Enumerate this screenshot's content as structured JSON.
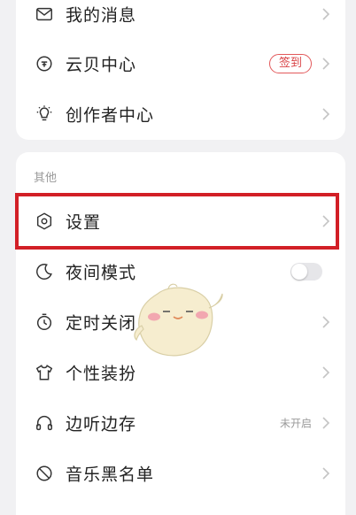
{
  "section_other_label": "其他",
  "menu": {
    "messages": {
      "label": "我的消息",
      "icon": "mail-icon"
    },
    "yunbei": {
      "label": "云贝中心",
      "badge": "签到",
      "icon": "yunbei-coin-icon"
    },
    "creator": {
      "label": "创作者中心",
      "icon": "lightbulb-icon"
    },
    "settings": {
      "label": "设置",
      "icon": "settings-hexagon-icon"
    },
    "night_mode": {
      "label": "夜间模式",
      "icon": "moon-icon",
      "toggle_on": false
    },
    "timer_close": {
      "label": "定时关闭",
      "icon": "timer-icon"
    },
    "theme": {
      "label": "个性装扮",
      "icon": "tshirt-icon"
    },
    "listen_save": {
      "label": "边听边存",
      "status": "未开启",
      "icon": "headphones-icon"
    },
    "blacklist": {
      "label": "音乐黑名单",
      "icon": "block-icon"
    }
  },
  "colors": {
    "highlight_border": "#d21f26",
    "badge_red": "#d94346",
    "background": "#f1f1f3",
    "card": "#ffffff"
  }
}
